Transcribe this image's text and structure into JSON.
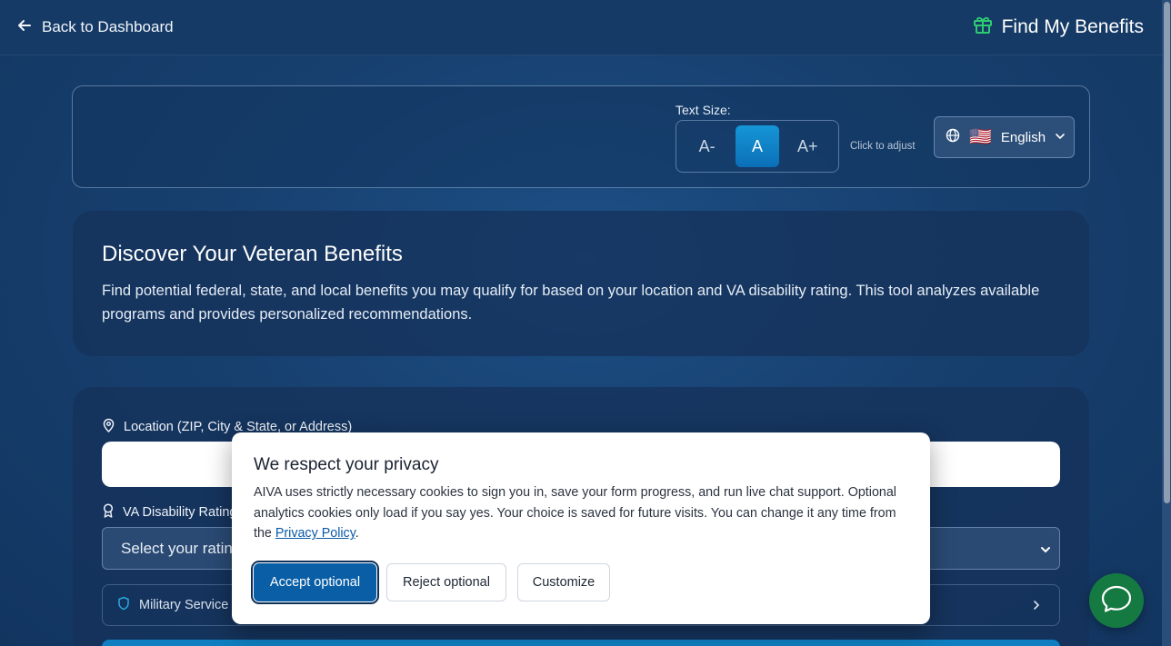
{
  "nav": {
    "back_label": "Back to Dashboard",
    "brand_title": "Find My Benefits",
    "brand_icon": "gift-icon"
  },
  "accessibility": {
    "text_size_label": "Text Size:",
    "size_options": [
      "A-",
      "A",
      "A+"
    ],
    "selected_size": "A",
    "adjust_hint": "Click to adjust",
    "language": {
      "flag": "🇺🇸",
      "label": "English"
    }
  },
  "intro": {
    "title": "Discover Your Veteran Benefits",
    "description": "Find potential federal, state, and local benefits you may qualify for based on your location and VA disability rating. This tool analyzes available programs and provides personalized recommendations."
  },
  "form": {
    "location_label": "Location (ZIP, City & State, or Address)",
    "location_value": "",
    "rating_label": "VA Disability Rating",
    "rating_placeholder": "Select your rating",
    "military_label": "Military Service"
  },
  "cookie": {
    "title": "We respect your privacy",
    "text_before_link": "AIVA uses strictly necessary cookies to sign you in, save your form progress, and run live chat support. Optional analytics cookies only load if you say yes. Your choice is saved for future visits. You can change it any time from the ",
    "link_label": "Privacy Policy",
    "text_after_link": ".",
    "accept_label": "Accept optional",
    "reject_label": "Reject optional",
    "customize_label": "Customize"
  },
  "colors": {
    "accent": "#0a5ea6",
    "chat": "#157a42",
    "brand_icon": "#2ecc71"
  }
}
